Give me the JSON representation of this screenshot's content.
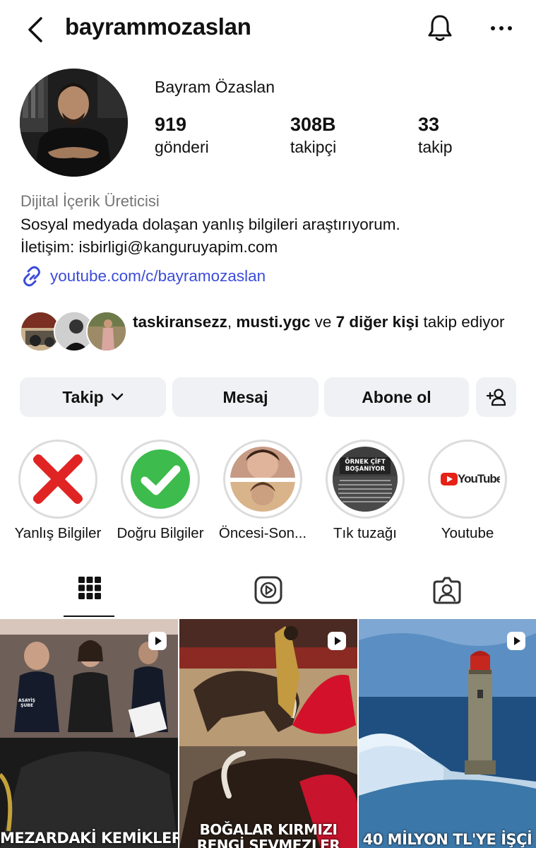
{
  "header": {
    "username": "bayrammozaslan"
  },
  "profile": {
    "display_name": "Bayram Özaslan",
    "stats": [
      {
        "value": "919",
        "label": "gönderi"
      },
      {
        "value": "308B",
        "label": "takipçi"
      },
      {
        "value": "33",
        "label": "takip"
      }
    ],
    "category": "Dijital İçerik Üreticisi",
    "bio_line1": "Sosyal medyada dolaşan yanlış bilgileri araştırıyorum.",
    "bio_line2": "İletişim: isbirligi@kanguruyapim.com",
    "link": "youtube.com/c/bayramozaslan"
  },
  "followed_by": {
    "user1": "taskiransezz",
    "sep": ", ",
    "user2": "musti.ygc",
    "connector": " ve ",
    "others": "7 diğer kişi",
    "suffix": " takip ediyor"
  },
  "buttons": {
    "follow": "Takip",
    "message": "Mesaj",
    "subscribe": "Abone ol"
  },
  "highlights": [
    {
      "label": "Yanlış Bilgiler"
    },
    {
      "label": "Doğru Bilgiler"
    },
    {
      "label": "Öncesi-Son..."
    },
    {
      "label": "Tık tuzağı",
      "overlay": "ÖRNEK ÇİFT BOŞANIYOR"
    },
    {
      "label": "Youtube",
      "logo_text": "YouTube"
    }
  ],
  "posts": [
    {
      "caption": "MEZARDAKİ KEMİKLER",
      "badge": "ASAYİŞ ŞUBE"
    },
    {
      "caption": "BOĞALAR KIRMIZI",
      "caption2": "RENGİ SEVMEZLER"
    },
    {
      "caption": "40 MİLYON TL'YE İŞÇİ"
    }
  ],
  "colors": {
    "link": "#3b4bd9",
    "button_bg": "#eff1f4",
    "red_x": "#e02424",
    "green_check": "#3dbb4c"
  }
}
